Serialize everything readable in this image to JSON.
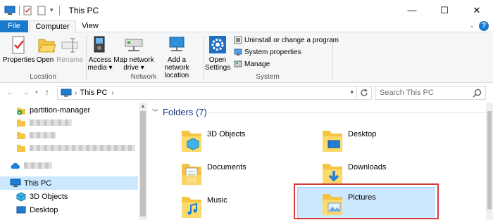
{
  "window": {
    "title": "This PC"
  },
  "controls": {
    "minimize": "—",
    "maximize": "☐",
    "close": "✕"
  },
  "tabs": [
    {
      "label": "File"
    },
    {
      "label": "Computer"
    },
    {
      "label": "View"
    }
  ],
  "help": "?",
  "ribbon": {
    "location": {
      "label": "Location",
      "buttons": [
        {
          "label": "Properties"
        },
        {
          "label": "Open"
        },
        {
          "label": "Rename"
        }
      ]
    },
    "network": {
      "label": "Network",
      "buttons": [
        {
          "line1": "Access",
          "line2": "media ▾"
        },
        {
          "line1": "Map network",
          "line2": "drive ▾"
        },
        {
          "line1": "Add a network",
          "line2": "location"
        }
      ]
    },
    "system": {
      "label": "System",
      "open_settings": {
        "line1": "Open",
        "line2": "Settings"
      },
      "items": [
        {
          "label": "Uninstall or change a program"
        },
        {
          "label": "System properties"
        },
        {
          "label": "Manage"
        }
      ]
    }
  },
  "address": {
    "crumb": "This PC",
    "sep": "›",
    "search_placeholder": "Search This PC"
  },
  "nav": {
    "items": [
      {
        "label": "partition-manager"
      },
      {
        "label": "This PC"
      },
      {
        "label": "3D Objects"
      },
      {
        "label": "Desktop"
      }
    ]
  },
  "content": {
    "section": "Folders (7)",
    "folders": [
      {
        "label": "3D Objects"
      },
      {
        "label": "Desktop"
      },
      {
        "label": "Documents"
      },
      {
        "label": "Downloads"
      },
      {
        "label": "Music"
      },
      {
        "label": "Pictures"
      }
    ]
  },
  "colors": {
    "accent": "#1979ca",
    "selection": "#cce8ff",
    "highlight_border": "#d63b3b",
    "folder": "#f5c443"
  }
}
